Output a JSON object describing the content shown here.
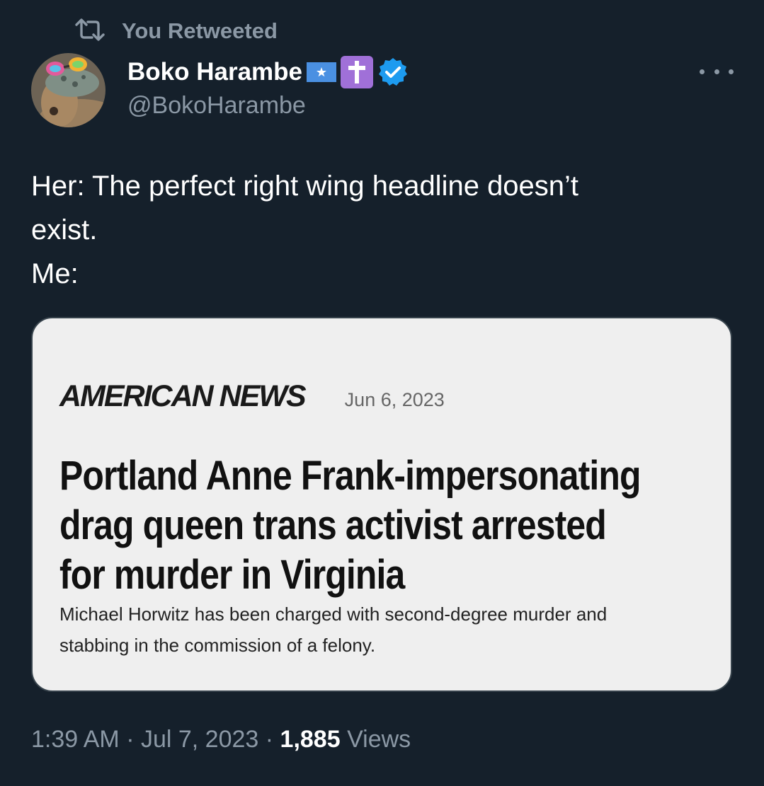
{
  "retweet_label": "You Retweeted",
  "author": {
    "name": "Boko Harambe",
    "handle": "@BokoHarambe",
    "badges": [
      "flag-badge",
      "cross-badge",
      "verified-badge"
    ]
  },
  "tweet": {
    "lines": [
      "Her: The perfect right wing headline doesn’t",
      "exist.",
      "Me:"
    ]
  },
  "card": {
    "outlet": "AMERICAN NEWS",
    "date": "Jun 6, 2023",
    "headline_lines": [
      "Portland Anne Frank-impersonating",
      "drag queen trans activist arrested",
      "for murder in Virginia"
    ],
    "dek_lines": [
      "Michael Horwitz has been charged with second-degree murder and",
      "stabbing in the commission of a felony."
    ]
  },
  "meta": {
    "time": "1:39 AM",
    "sep1": " · ",
    "date": "Jul 7, 2023",
    "sep2": " · ",
    "views_count": "1,885",
    "views_label": " Views"
  },
  "colors": {
    "background": "#15202b",
    "muted": "#8b98a5",
    "verified": "#1d9bf0",
    "cross_badge": "#a070d8",
    "flag_badge": "#4a90e2"
  }
}
